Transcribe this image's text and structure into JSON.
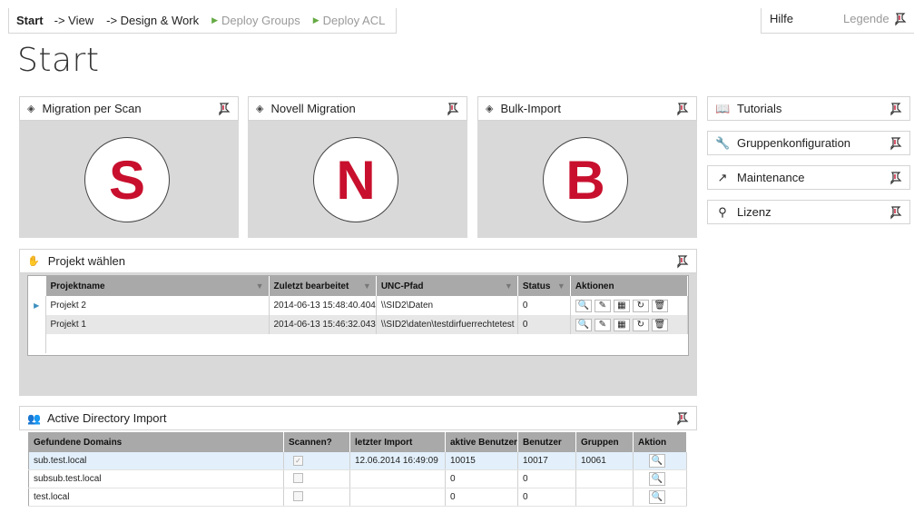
{
  "nav": {
    "start": "Start",
    "view": "-> View",
    "design": "-> Design & Work",
    "deploy_groups": "Deploy Groups",
    "deploy_acl": "Deploy ACL",
    "hilfe": "Hilfe",
    "legende": "Legende"
  },
  "page_title": "Start",
  "tiles": [
    {
      "label": "Migration per Scan",
      "letter": "S"
    },
    {
      "label": "Novell Migration",
      "letter": "N"
    },
    {
      "label": "Bulk-Import",
      "letter": "B"
    }
  ],
  "right_panels": [
    {
      "label": "Tutorials",
      "icon": "book-icon"
    },
    {
      "label": "Gruppenkonfiguration",
      "icon": "wrench-icon"
    },
    {
      "label": "Maintenance",
      "icon": "hammer-icon"
    },
    {
      "label": "Lizenz",
      "icon": "key-icon"
    }
  ],
  "project": {
    "title": "Projekt wählen",
    "columns": [
      "Projektname",
      "Zuletzt bearbeitet",
      "UNC-Pfad",
      "Status",
      "Aktionen"
    ],
    "rows": [
      {
        "name": "Projekt 2",
        "edited": "2014-06-13 15:48:40.404",
        "unc": "\\\\SID2\\Daten",
        "status": "0"
      },
      {
        "name": "Projekt 1",
        "edited": "2014-06-13 15:46:32.043",
        "unc": "\\\\SID2\\daten\\testdirfuerrechtetest",
        "status": "0"
      }
    ]
  },
  "ad": {
    "title": "Active Directory Import",
    "columns": [
      "Gefundene Domains",
      "Scannen?",
      "letzter Import",
      "aktive Benutzer",
      "Benutzer",
      "Gruppen",
      "Aktion"
    ],
    "rows": [
      {
        "domain": "sub.test.local",
        "checked": true,
        "last": "12.06.2014 16:49:09",
        "active": "10015",
        "users": "10017",
        "groups": "10061"
      },
      {
        "domain": "subsub.test.local",
        "checked": false,
        "last": "",
        "active": "0",
        "users": "0",
        "groups": ""
      },
      {
        "domain": "test.local",
        "checked": false,
        "last": "",
        "active": "0",
        "users": "0",
        "groups": ""
      }
    ]
  },
  "colors": {
    "accent_red": "#c8102e",
    "tile_bg": "#d9d9d9",
    "header_grey": "#a9a9a9"
  }
}
